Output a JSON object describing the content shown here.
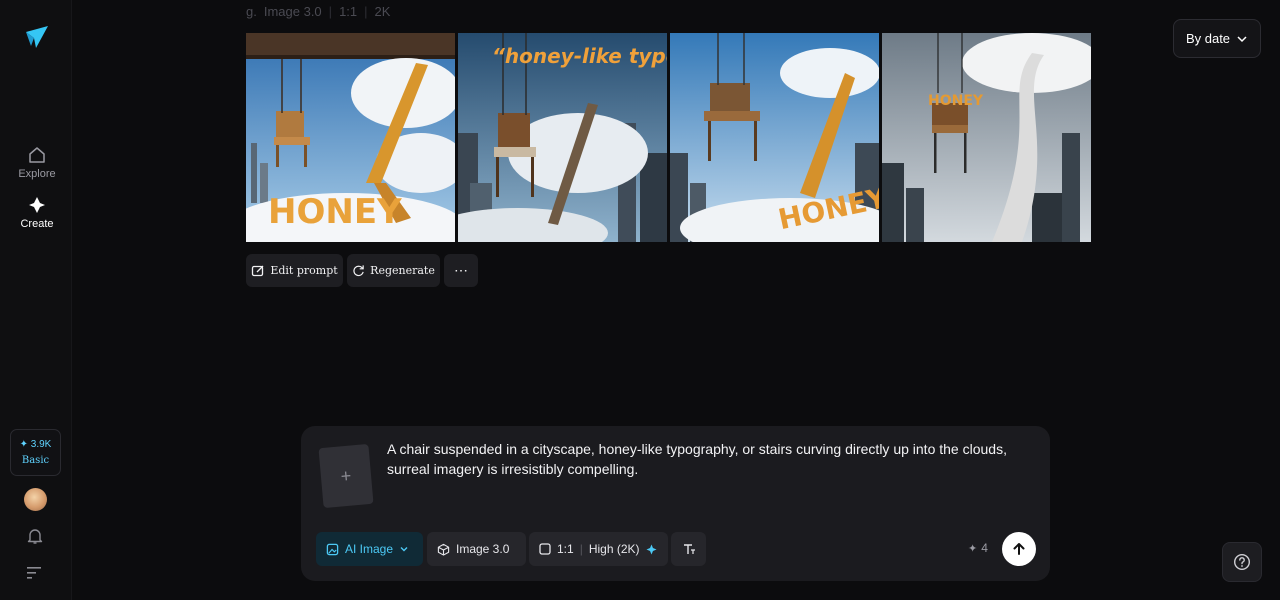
{
  "sidebar": {
    "logo": "app-logo",
    "nav": [
      {
        "label": "Explore",
        "icon": "home-icon"
      },
      {
        "label": "Create",
        "icon": "sparkle-icon"
      }
    ],
    "credits": {
      "amount": "✦ 3.9K",
      "plan": "Basic"
    },
    "icons": [
      "bell-icon",
      "menu-icon"
    ]
  },
  "header": {
    "meta_prefix": "g.",
    "model": "Image 3.0",
    "ratio": "1:1",
    "resolution": "2K",
    "sort_label": "By date"
  },
  "gallery": {
    "images": [
      {
        "caption": "HONEY"
      },
      {
        "caption": "“honey-like typography.”"
      },
      {
        "caption": "HONEY"
      },
      {
        "caption": "HONEY"
      }
    ]
  },
  "actions": {
    "edit_label": "Edit prompt",
    "regen_label": "Regenerate",
    "more_label": "⋯"
  },
  "composer": {
    "add_label": "+",
    "prompt": "A chair suspended in a cityscape, honey-like typography, or stairs curving directly up into the clouds, surreal imagery is irresistibly compelling.",
    "type_label": "AI Image",
    "model_label": "Image 3.0",
    "ratio_label": "1:1",
    "quality_label": "High (2K)",
    "count_label": "4"
  },
  "colors": {
    "accent": "#4cc9f5",
    "background": "#0c0c0e",
    "panel": "#1b1b1f"
  }
}
